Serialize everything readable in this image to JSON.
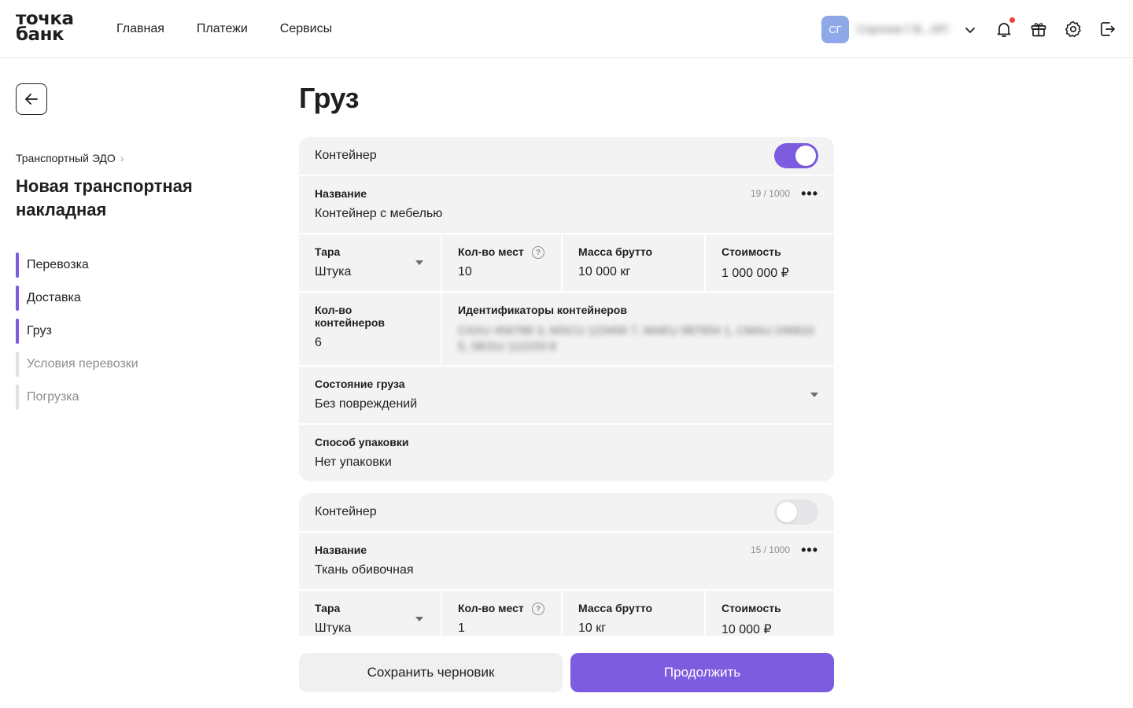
{
  "brand": {
    "line1": "точка",
    "line2": "банк"
  },
  "nav": [
    "Главная",
    "Платежи",
    "Сервисы"
  ],
  "user": {
    "initials": "СГ",
    "name": "Сергеев Г.В., ИП"
  },
  "colors": {
    "accent": "#7d5cdf",
    "notification_dot": "#e8453c",
    "avatar": "#8ea8e8"
  },
  "icons": [
    "back-arrow-icon",
    "chevron-down-icon",
    "bell-icon",
    "gift-icon",
    "gear-icon",
    "logout-icon",
    "more-dots-icon",
    "help-icon"
  ],
  "sidebar": {
    "breadcrumb": "Транспортный ЭДО",
    "title": "Новая транспортная накладная",
    "steps": [
      {
        "label": "Перевозка",
        "done": true
      },
      {
        "label": "Доставка",
        "done": true
      },
      {
        "label": "Груз",
        "done": true
      },
      {
        "label": "Условия перевозки",
        "done": false
      },
      {
        "label": "Погрузка",
        "done": false
      }
    ]
  },
  "page": {
    "title": "Груз"
  },
  "labels": {
    "container": "Контейнер",
    "name": "Название",
    "tara": "Тара",
    "places": "Кол-во мест",
    "mass": "Масса брутто",
    "cost": "Стоимость",
    "containers_count": "Кол-во контейнеров",
    "container_ids": "Идентификаторы контейнеров",
    "state": "Состояние груза",
    "packing": "Способ упаковки"
  },
  "cargo": [
    {
      "container_on": true,
      "name": "Контейнер с мебелью",
      "counter": "19 / 1000",
      "tara": "Штука",
      "places": "10",
      "mass": "10 000 кг",
      "cost": "1 000 000 ₽",
      "containers_count": "6",
      "container_ids": "CAXU 456789 3, MSCU 123456 7, MAEU 987654 1, CMAU 246810 5, SEGU 112233 8",
      "state": "Без повреждений",
      "packing": "Нет упаковки"
    },
    {
      "container_on": false,
      "name": "Ткань обивочная",
      "counter": "15 / 1000",
      "tara": "Штука",
      "places": "1",
      "mass": "10 кг",
      "cost": "10 000 ₽"
    }
  ],
  "buttons": {
    "save_draft": "Сохранить черновик",
    "continue": "Продолжить"
  }
}
